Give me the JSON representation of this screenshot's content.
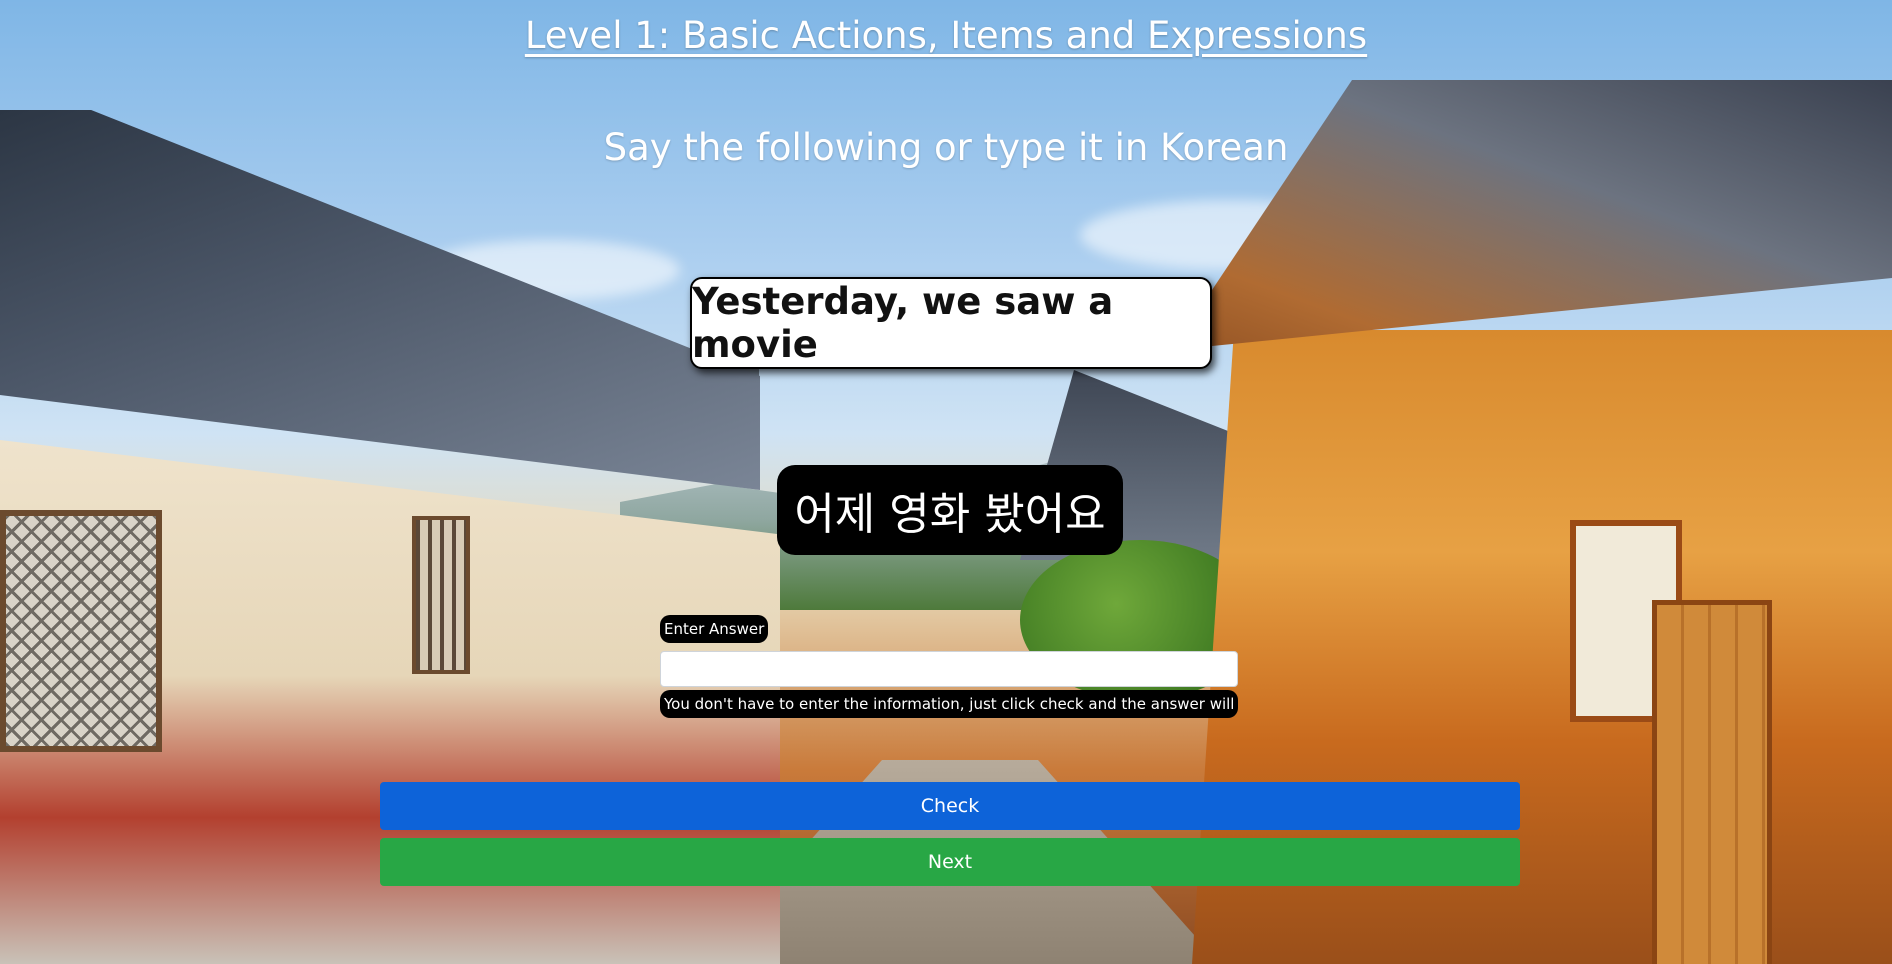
{
  "page": {
    "title": "Level 1: Basic Actions, Items and Expressions",
    "instruction": "Say the following or type it in Korean"
  },
  "prompt": {
    "english": "Yesterday, we saw a movie",
    "korean": "어제 영화 봤어요"
  },
  "form": {
    "label": "Enter Answer",
    "input_value": "",
    "hint": "You don't have to enter the information, just click check and the answer will show"
  },
  "buttons": {
    "check": "Check",
    "next": "Next"
  },
  "colors": {
    "check_button": "#0d63d9",
    "next_button": "#28a745",
    "title_text": "#ffffff"
  }
}
